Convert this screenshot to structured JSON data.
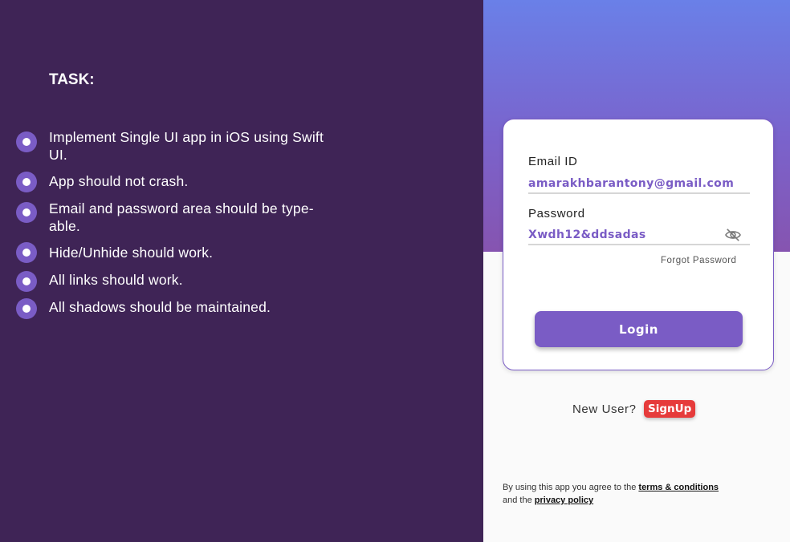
{
  "task": {
    "title": "TASK:",
    "items": [
      "Implement Single UI app in iOS   using Swift UI.",
      "App should not crash.",
      "Email and password area should be type-able.",
      "Hide/Unhide should work.",
      "All links should work.",
      "All shadows should be maintained."
    ]
  },
  "login": {
    "email_label": "Email ID",
    "email_value": "amarakhbarantony@gmail.com",
    "password_label": "Password",
    "password_value": "Xwdh12&ddsadas",
    "forgot_label": "Forgot Password",
    "login_label": "Login",
    "new_user_text": "New User?",
    "signup_label": "SignUp",
    "terms_prefix": "By using this app you agree to the",
    "terms_link": "terms & conditions ",
    "terms_middle": "and the",
    "privacy_link": "privacy policy"
  },
  "colors": {
    "left_bg": "#3f2456",
    "accent": "#7a5cc5",
    "signup": "#e63b3b",
    "gradient_top": "#6a80e8",
    "gradient_bottom": "#8654b0"
  },
  "icons": {
    "bullet": "bullet-dot-icon",
    "password_toggle": "eye-slash-icon"
  }
}
